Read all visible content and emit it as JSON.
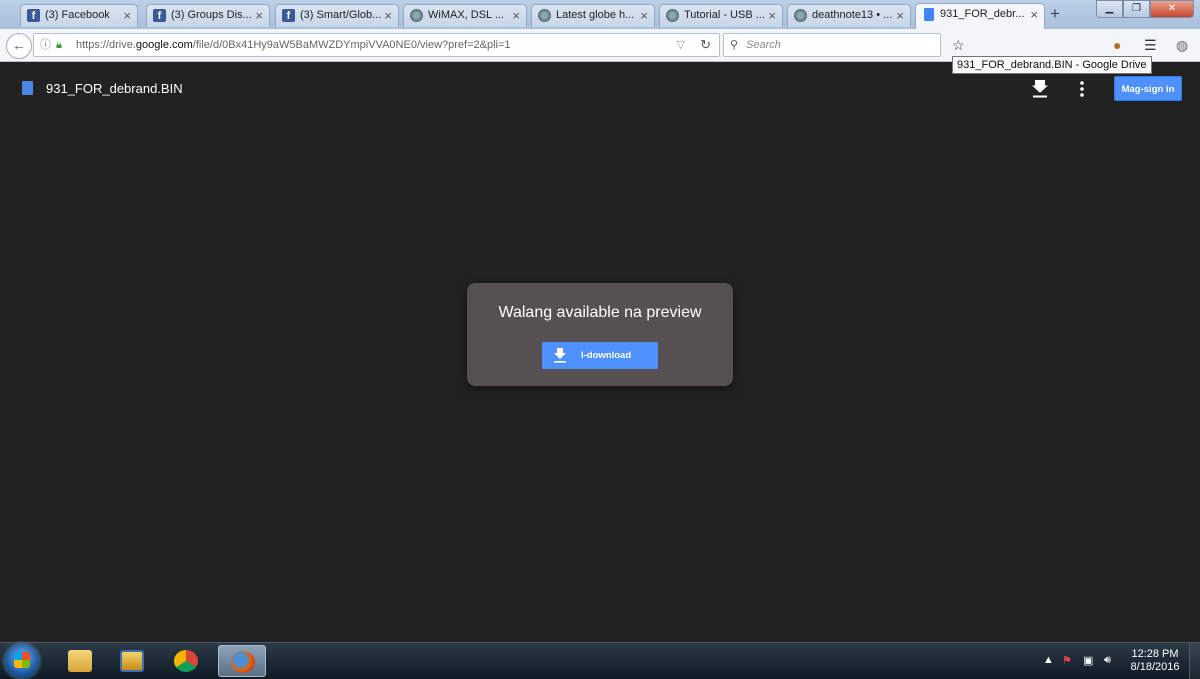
{
  "browser": {
    "tabs": [
      {
        "label": "(3) Facebook",
        "icon": "facebook-icon"
      },
      {
        "label": "(3) Groups Dis...",
        "icon": "facebook-icon"
      },
      {
        "label": "(3) Smart/Glob...",
        "icon": "facebook-icon"
      },
      {
        "label": "WiMAX, DSL ...",
        "icon": "forum-icon"
      },
      {
        "label": "Latest globe h...",
        "icon": "forum-icon"
      },
      {
        "label": "Tutorial - USB ...",
        "icon": "forum-icon"
      },
      {
        "label": "deathnote13 • ...",
        "icon": "forum-icon"
      },
      {
        "label": "931_FOR_debr...",
        "icon": "drive-doc-icon",
        "active": true
      }
    ],
    "new_tab": "+",
    "url_host_prefix": "https://drive.",
    "url_host": "google.com",
    "url_path": "/file/d/0Bx41Hy9aW5BaMWZDYmpiVVA0NE0/view?pref=2&pli=1",
    "search_placeholder": "Search",
    "tooltip": "931_FOR_debrand.BIN - Google Drive"
  },
  "drive": {
    "file_name": "931_FOR_debrand.BIN",
    "sign_in_label": "Mag-sign in",
    "preview_message": "Walang available na preview",
    "download_label": "I-download"
  },
  "taskbar": {
    "apps": [
      "file-explorer-icon",
      "media-player-icon",
      "chrome-icon",
      "firefox-icon"
    ],
    "time": "12:28 PM",
    "date": "8/18/2016"
  }
}
